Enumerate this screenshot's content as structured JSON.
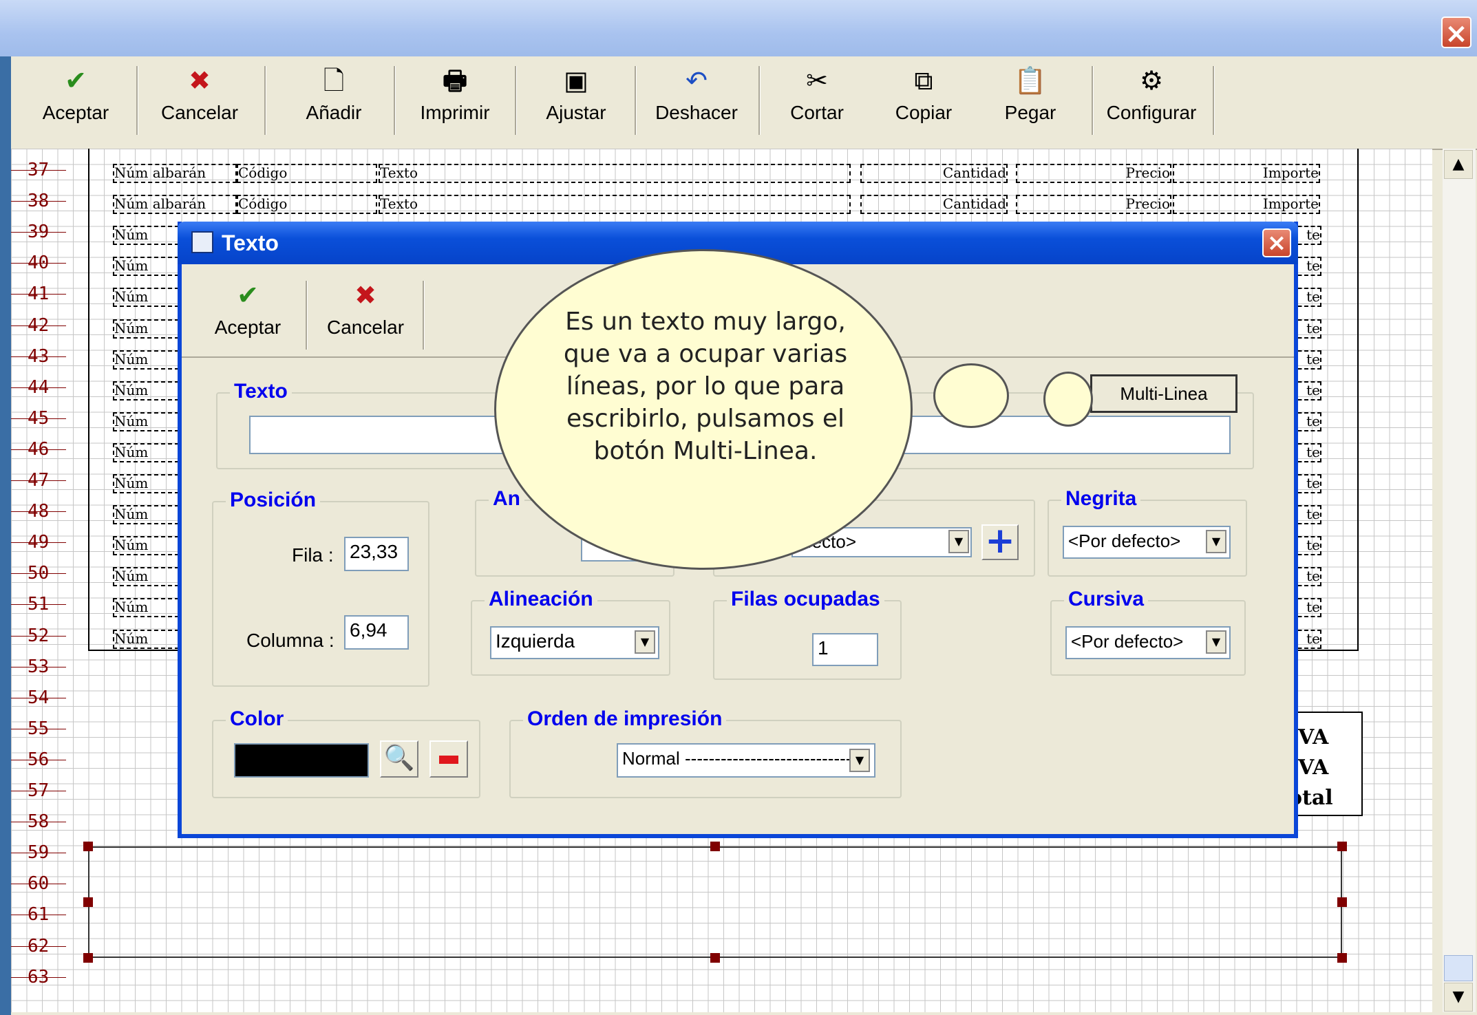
{
  "toolbar": {
    "aceptar": "Aceptar",
    "cancelar": "Cancelar",
    "anadir": "Añadir",
    "imprimir": "Imprimir",
    "ajustar": "Ajustar",
    "deshacer": "Deshacer",
    "cortar": "Cortar",
    "copiar": "Copiar",
    "pegar": "Pegar",
    "configurar": "Configurar"
  },
  "row_numbers": [
    "37",
    "38",
    "39",
    "40",
    "41",
    "42",
    "43",
    "44",
    "45",
    "46",
    "47",
    "48",
    "49",
    "50",
    "51",
    "52",
    "53",
    "54",
    "55",
    "56",
    "57",
    "58",
    "59",
    "60",
    "61",
    "62",
    "63"
  ],
  "report": {
    "num_albaran": "Núm albarán",
    "num_short": "Núm",
    "codigo": "Código",
    "texto": "Texto",
    "cantidad": "Cantidad",
    "precio": "Precio",
    "importe": "Importe",
    "importe_short": "te",
    "iva": "IVA",
    "total": "otal"
  },
  "dialog": {
    "title": "Texto",
    "aceptar": "Aceptar",
    "cancelar": "Cancelar",
    "texto_group": "Texto",
    "texto_value": "",
    "multilinea": "Multi-Linea",
    "posicion_group": "Posición",
    "fila_label": "Fila :",
    "fila_value": "23,33",
    "columna_label": "Columna :",
    "columna_value": "6,94",
    "ancho_group": "An",
    "fuente_value": "efecto>",
    "negrita_group": "Negrita",
    "negrita_value": "<Por defecto>",
    "alineacion_group": "Alineación",
    "alineacion_value": "Izquierda",
    "filas_group": "Filas ocupadas",
    "filas_value": "1",
    "cursiva_group": "Cursiva",
    "cursiva_value": "<Por defecto>",
    "color_group": "Color",
    "color_value": "#000000",
    "orden_group": "Orden de impresión",
    "orden_value": "Normal -----------------------------"
  },
  "callout": "Es un texto muy largo, que va a ocupar varias líneas, por lo que para escribirlo, pulsamos el botón Multi-Linea."
}
